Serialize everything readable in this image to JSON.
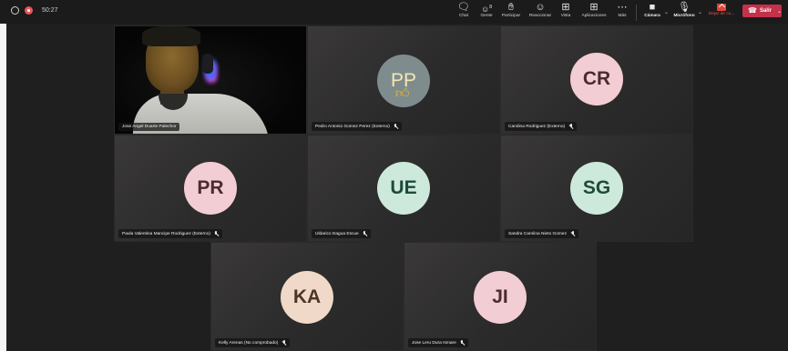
{
  "status": {
    "timer": "50:27"
  },
  "toolbar": {
    "items": [
      {
        "label": "Chat",
        "icon": "chat-icon"
      },
      {
        "label": "Gente",
        "icon": "people-icon"
      },
      {
        "label": "Participar",
        "icon": "raise-hand-icon"
      },
      {
        "label": "Reaccionar",
        "icon": "emoji-icon"
      },
      {
        "label": "Vista",
        "icon": "grid-view-icon"
      },
      {
        "label": "Aplicaciones",
        "icon": "apps-icon"
      },
      {
        "label": "Más",
        "icon": "more-icon"
      }
    ],
    "camera_label": "Cámara",
    "mic_label": "Micrófono",
    "share_label": "Dejar de co...",
    "leave_label": "Salir",
    "people_count": "8"
  },
  "participants": [
    {
      "name": "Jose Angel Duarte Palechor",
      "initials": "",
      "avatar_color": "",
      "video": true
    },
    {
      "name": "Pedro Antonio Gomez Perez (Externo)",
      "initials": "PP",
      "avatar_color": "#7f8c8d",
      "video": false
    },
    {
      "name": "Carolina Rodriguez (Externo)",
      "initials": "CR",
      "avatar_color": "#f2cdd3",
      "video": false
    },
    {
      "name": "Paula Valentina Mancipe Rodriguez (Externo)",
      "initials": "PR",
      "avatar_color": "#f2cdd3",
      "video": false
    },
    {
      "name": "Uldarico Dagua Escue",
      "initials": "UE",
      "avatar_color": "#cde9dc",
      "video": false
    },
    {
      "name": "Sandra Carolina Nieto Gomez",
      "initials": "SG",
      "avatar_color": "#cde9dc",
      "video": false
    },
    {
      "name": "Kelly Arenas (No comprobado)",
      "initials": "KA",
      "avatar_color": "#f0d9c8",
      "video": false
    },
    {
      "name": "Jose Leru Dura Ismare",
      "initials": "JI",
      "avatar_color": "#f2cdd3",
      "video": false
    }
  ],
  "colors": {
    "leave": "#c4314b",
    "recording": "#e8575b",
    "background": "#1f1f1f"
  }
}
